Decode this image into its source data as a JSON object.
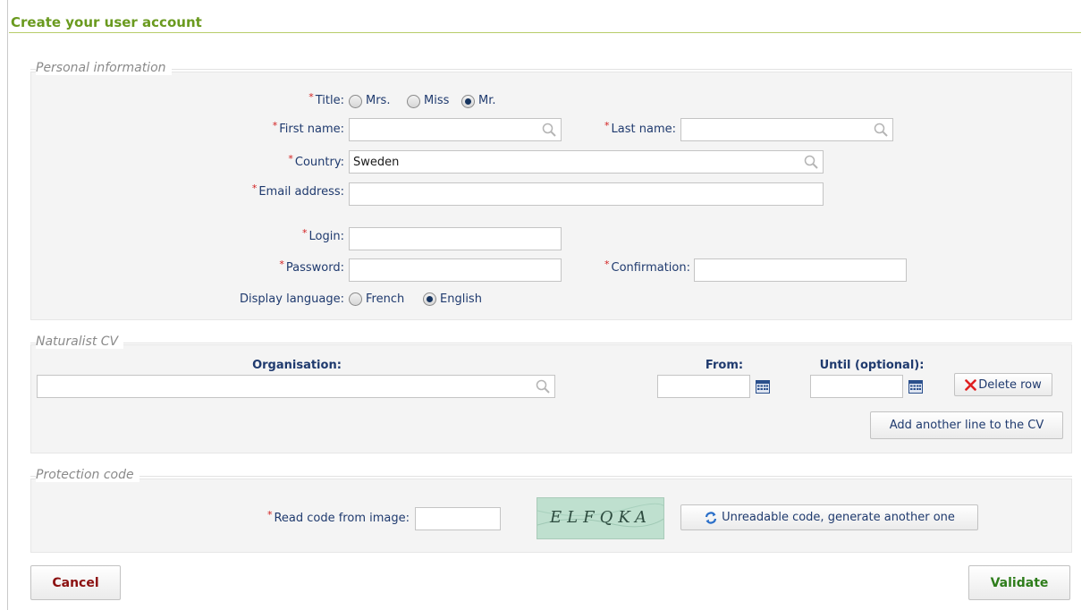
{
  "page": {
    "title": "Create your user account"
  },
  "personal": {
    "legend": "Personal information",
    "title_label": "Title:",
    "title_options": [
      "Mrs.",
      "Miss",
      "Mr."
    ],
    "title_selected": "Mr.",
    "first_name_label": "First name:",
    "first_name_value": "",
    "last_name_label": "Last name:",
    "last_name_value": "",
    "country_label": "Country:",
    "country_value": "Sweden",
    "email_label": "Email address:",
    "email_value": "",
    "login_label": "Login:",
    "login_value": "",
    "password_label": "Password:",
    "confirmation_label": "Confirmation:",
    "display_language_label": "Display language:",
    "language_options": [
      "French",
      "English"
    ],
    "language_selected": "English",
    "required_marker": "*"
  },
  "cv": {
    "legend": "Naturalist CV",
    "organisation_header": "Organisation:",
    "from_header": "From:",
    "until_header": "Until (optional):",
    "organisation_value": "",
    "from_value": "",
    "until_value": "",
    "delete_row_label": "Delete row",
    "add_line_label": "Add another line to the CV"
  },
  "protection": {
    "legend": "Protection code",
    "read_code_label": "Read code from image:",
    "code_value": "",
    "captcha_text": "ELFQKA",
    "regenerate_label": "Unreadable code, generate another one"
  },
  "actions": {
    "cancel_label": "Cancel",
    "validate_label": "Validate"
  },
  "colors": {
    "title_green": "#6a9a1f",
    "label_blue": "#1f3a6e",
    "required_red": "#d21e1e",
    "cancel_red": "#8b1010",
    "validate_green": "#2e7d1b"
  },
  "icons": [
    "magnifier-icon",
    "calendar-icon",
    "delete-x-icon",
    "refresh-icon"
  ]
}
